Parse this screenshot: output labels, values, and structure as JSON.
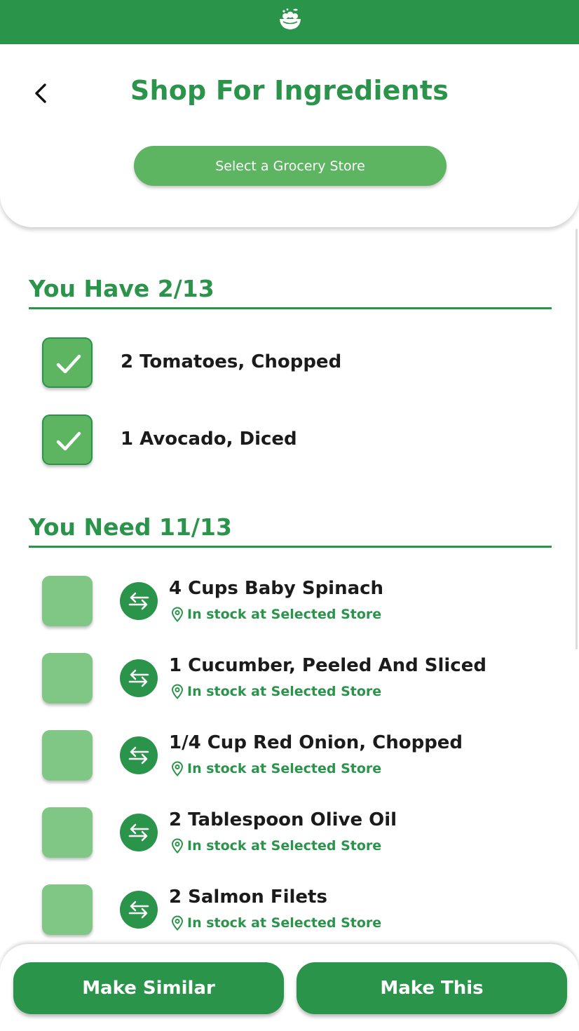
{
  "header": {
    "title": "Shop For Ingredients",
    "logo_icon": "salad-bowl-icon",
    "back_icon": "chevron-left-icon",
    "store_button_label": "Select a Grocery Store"
  },
  "have_section": {
    "heading": "You Have 2/13",
    "items": [
      {
        "label": "2 Tomatoes, Chopped",
        "checked": true
      },
      {
        "label": "1 Avocado, Diced",
        "checked": true
      }
    ]
  },
  "need_section": {
    "heading": "You Need 11/13",
    "items": [
      {
        "label": "4 Cups Baby Spinach",
        "status": "In stock at Selected Store",
        "checked": false
      },
      {
        "label": "1 Cucumber, Peeled And Sliced",
        "status": "In stock at Selected Store",
        "checked": false
      },
      {
        "label": "1/4 Cup Red Onion, Chopped",
        "status": "In stock at Selected Store",
        "checked": false
      },
      {
        "label": "2 Tablespoon Olive Oil",
        "status": "In stock at Selected Store",
        "checked": false
      },
      {
        "label": "2 Salmon Filets",
        "status": "In stock at Selected Store",
        "checked": false
      }
    ]
  },
  "footer": {
    "make_similar_label": "Make Similar",
    "make_this_label": "Make This"
  },
  "colors": {
    "brand_green": "#2b944b",
    "light_green": "#5db562",
    "unchecked_green": "#80c684"
  }
}
